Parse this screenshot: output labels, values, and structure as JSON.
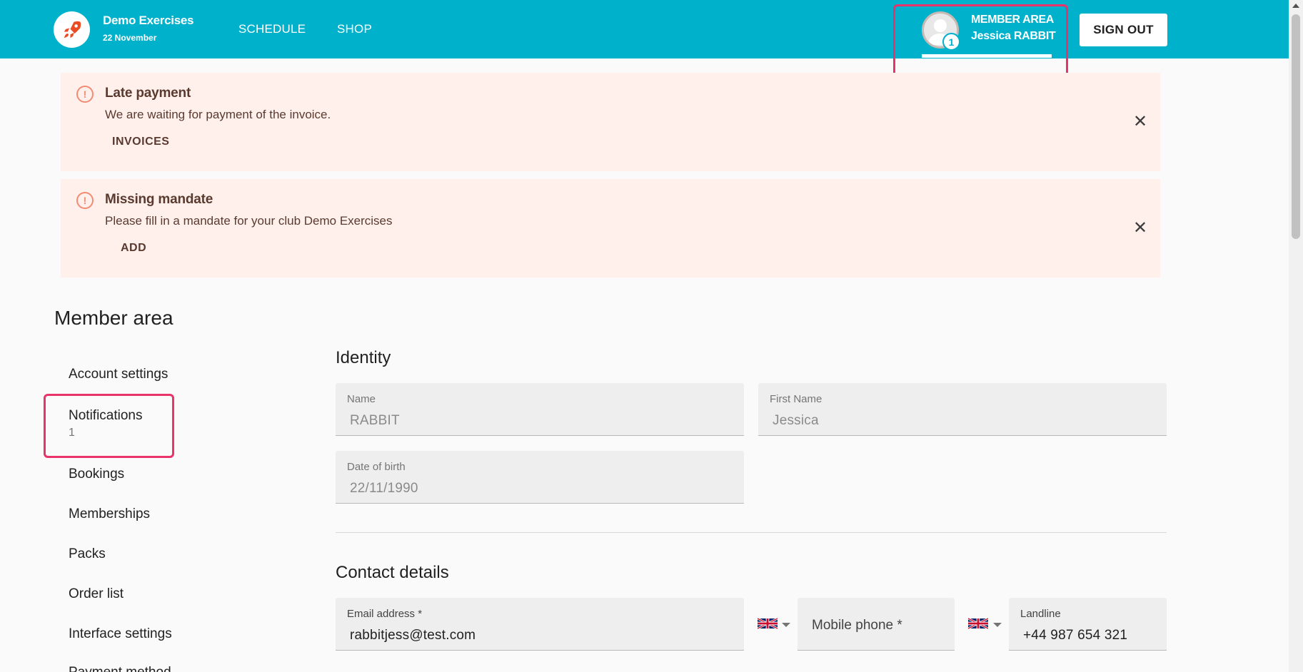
{
  "header": {
    "club_name": "Demo Exercises",
    "date": "22 November",
    "nav": {
      "schedule": "SCHEDULE",
      "shop": "SHOP"
    },
    "member": {
      "area_label": "MEMBER AREA",
      "name": "Jessica RABBIT",
      "badge_count": "1"
    },
    "signout_label": "SIGN OUT"
  },
  "alerts": [
    {
      "title": "Late payment",
      "text": "We are waiting for payment of the invoice.",
      "action": "INVOICES"
    },
    {
      "title": "Missing mandate",
      "text": "Please fill in a mandate for your club Demo Exercises",
      "action": "ADD"
    }
  ],
  "page_title": "Member area",
  "sidebar": {
    "items": [
      {
        "label": "Account settings"
      },
      {
        "label": "Notifications",
        "count": "1"
      },
      {
        "label": "Bookings"
      },
      {
        "label": "Memberships"
      },
      {
        "label": "Packs"
      },
      {
        "label": "Order list"
      },
      {
        "label": "Interface settings"
      },
      {
        "label": "Payment method"
      }
    ]
  },
  "identity": {
    "title": "Identity",
    "name": {
      "label": "Name",
      "value": "RABBIT"
    },
    "first_name": {
      "label": "First Name",
      "value": "Jessica"
    },
    "dob": {
      "label": "Date of birth",
      "value": "22/11/1990"
    }
  },
  "contact": {
    "title": "Contact details",
    "email": {
      "label": "Email address *",
      "value": "rabbitjess@test.com"
    },
    "mobile": {
      "placeholder": "Mobile phone *"
    },
    "landline": {
      "label": "Landline",
      "value": "+44 987 654 321"
    }
  },
  "colors": {
    "header_bg": "#00b1cc",
    "alert_bg": "#fff0ec",
    "highlight": "#e8336b"
  },
  "icons": [
    "rocket-icon",
    "user-avatar-icon",
    "warning-circle-icon",
    "close-icon",
    "uk-flag-icon",
    "caret-down-icon"
  ]
}
